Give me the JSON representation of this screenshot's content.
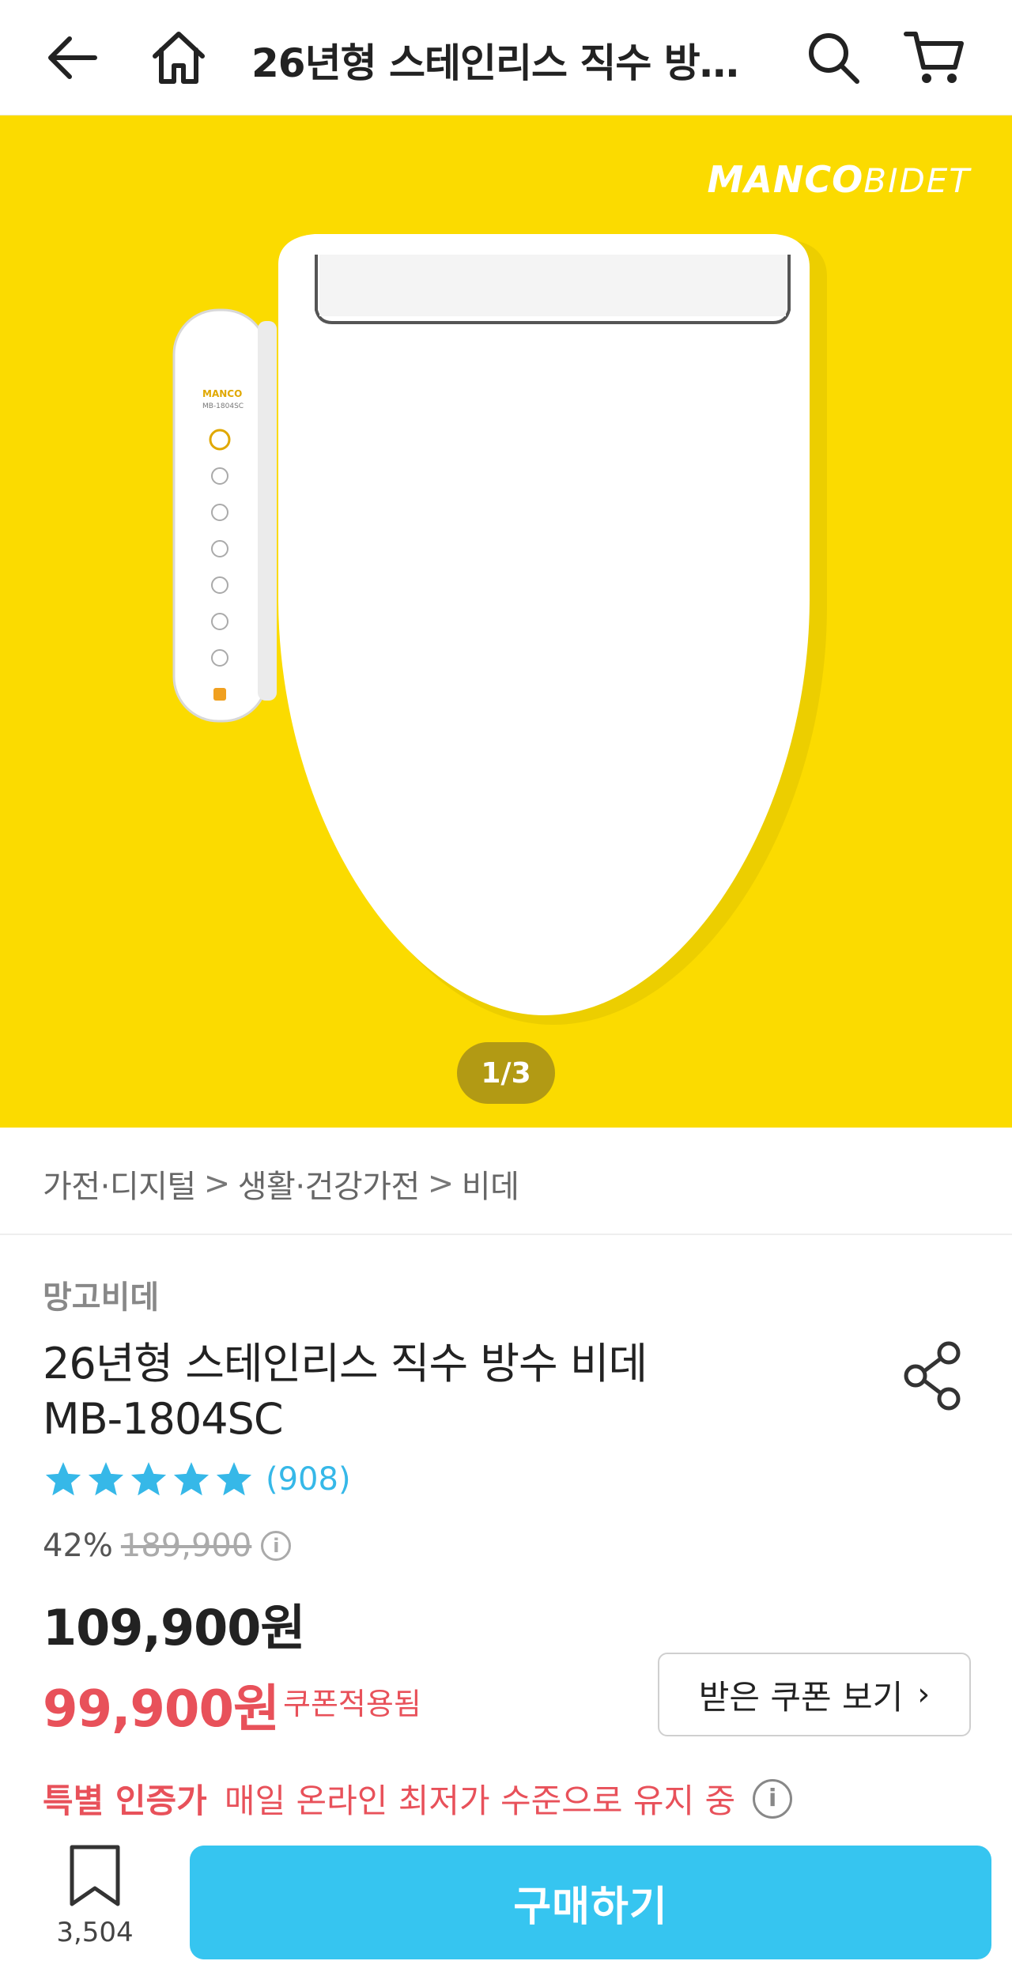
{
  "header": {
    "title": "26년형 스테인리스 직수 방…",
    "back_icon": "arrow-left-icon",
    "home_icon": "home-icon",
    "search_icon": "search-icon",
    "cart_icon": "cart-icon"
  },
  "hero": {
    "brand_logo_bold": "MANCO",
    "brand_logo_thin": "BIDET",
    "page_indicator": "1/3",
    "background_color": "#fbdb00"
  },
  "breadcrumb": {
    "items": [
      "가전·디지털",
      "생활·건강가전",
      "비데"
    ],
    "separator": ">"
  },
  "product": {
    "brand": "망고비데",
    "title_line1": "26년형 스테인리스 직수 방수 비데",
    "title_line2": "MB-1804SC",
    "rating_stars": 5,
    "review_count": "(908)",
    "discount_rate": "42%",
    "original_price": "189,900",
    "sale_price": "109,900원",
    "coupon_price": "99,900원",
    "coupon_note": "쿠폰적용됨",
    "coupon_button": "받은 쿠폰 보기",
    "special_label": "특별 인증가",
    "special_desc": "매일 온라인 최저가 수준으로 유지 중"
  },
  "bottom_bar": {
    "wishlist_count": "3,504",
    "buy_label": "구매하기",
    "buy_color": "#36c5f0"
  },
  "colors": {
    "accent_red": "#e8515a",
    "star_blue": "#36b8e8"
  }
}
